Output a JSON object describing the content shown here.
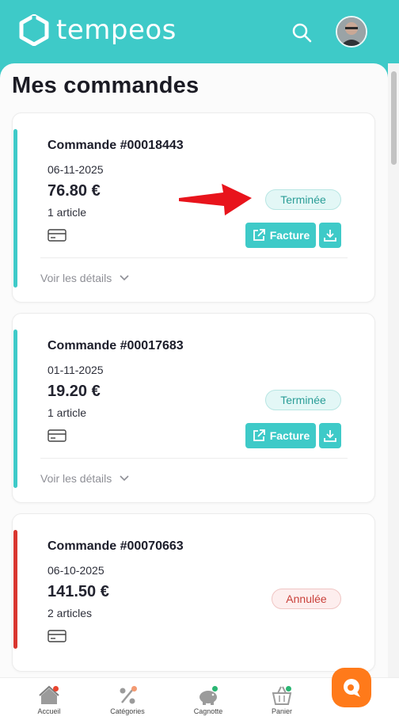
{
  "header": {
    "logo_text": "tempeos",
    "search_icon": "search-icon",
    "avatar_alt": "user-avatar",
    "brand_color": "#3ecac8"
  },
  "page": {
    "title": "Mes commandes"
  },
  "orders": [
    {
      "number": "Commande #00018443",
      "date": "06-11-2025",
      "amount": "76.80 €",
      "items": "1 article",
      "status": "Terminée",
      "status_type": "done",
      "invoice_label": "Facture",
      "details_label": "Voir les détails"
    },
    {
      "number": "Commande #00017683",
      "date": "01-11-2025",
      "amount": "19.20 €",
      "items": "1 article",
      "status": "Terminée",
      "status_type": "done",
      "invoice_label": "Facture",
      "details_label": "Voir les détails"
    },
    {
      "number": "Commande #00070663",
      "date": "06-10-2025",
      "amount": "141.50 €",
      "items": "2 articles",
      "status": "Annulée",
      "status_type": "cancel"
    }
  ],
  "bottom_nav": [
    {
      "label": "Accueil",
      "icon": "home-icon",
      "dot_color": "#e8452f"
    },
    {
      "label": "Catégories",
      "icon": "percent-icon",
      "dot_color": "#f39a72"
    },
    {
      "label": "Cagnotte",
      "icon": "piggy-bank-icon",
      "dot_color": "#2ab673"
    },
    {
      "label": "Panier",
      "icon": "basket-icon",
      "dot_color": "#2ab673"
    }
  ],
  "colors": {
    "accent": "#3ecac8",
    "done": "#2a9d97",
    "cancel": "#c9413b",
    "chat": "#ff7a1a",
    "annotation_arrow": "#e8141c"
  }
}
